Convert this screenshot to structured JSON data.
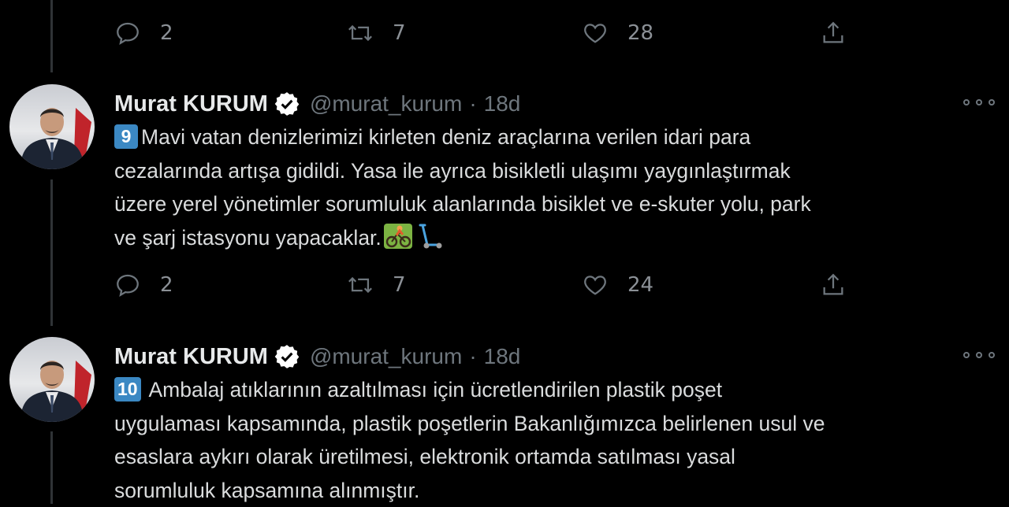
{
  "top_actions": {
    "reply_count": "2",
    "retweet_count": "7",
    "like_count": "28"
  },
  "tweets": [
    {
      "name": "Murat KURUM",
      "handle": "@murat_kurum",
      "separator": "·",
      "time": "18d",
      "number_badge": "9",
      "text": "Mavi vatan denizlerimizi kirleten deniz araçlarına verilen idari para\ncezalarında artışa gidildi. Yasa ile ayrıca bisikletli ulaşımı yaygınlaştırmak\nüzere yerel yönetimler sorumluluk alanlarında bisiklet ve e-skuter yolu, park\nve şarj istasyonu yapacaklar.",
      "emojis": [
        "person-biking-icon",
        "kick-scooter-icon"
      ],
      "reply_count": "2",
      "retweet_count": "7",
      "like_count": "24"
    },
    {
      "name": "Murat KURUM",
      "handle": "@murat_kurum",
      "separator": "·",
      "time": "18d",
      "number_badge": "10",
      "text": " Ambalaj atıklarının azaltılması için ücretlendirilen plastik poşet\nuygulaması kapsamında, plastik poşetlerin Bakanlığımızca belirlenen usul ve\nesaslara aykırı olarak üretilmesi, elektronik ortamda satılması yasal\nsorumluluk kapsamına alınmıştır."
    }
  ],
  "colors": {
    "background": "#000000",
    "muted": "#6e767d",
    "text": "#d9d9d9",
    "keycap": "#3b88c3",
    "verified": "#ffffff"
  }
}
